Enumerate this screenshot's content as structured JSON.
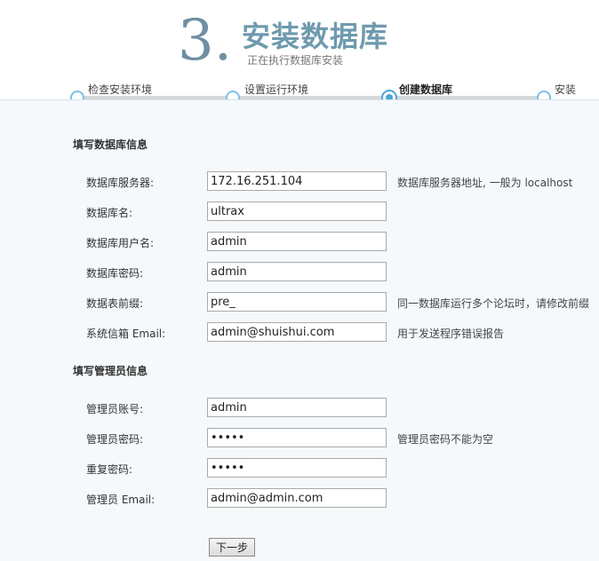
{
  "header": {
    "step_number": "3.",
    "title": "安装数据库",
    "subtitle": "正在执行数据库安装"
  },
  "steps": [
    {
      "label": "检查安装环境",
      "state": "done"
    },
    {
      "label": "设置运行环境",
      "state": "done"
    },
    {
      "label": "创建数据库",
      "state": "active"
    },
    {
      "label": "安装",
      "state": "pending"
    }
  ],
  "db_section": {
    "title": "填写数据库信息",
    "fields": [
      {
        "label": "数据库服务器:",
        "value": "172.16.251.104",
        "hint": "数据库服务器地址, 一般为 localhost"
      },
      {
        "label": "数据库名:",
        "value": "ultrax",
        "hint": ""
      },
      {
        "label": "数据库用户名:",
        "value": "admin",
        "hint": ""
      },
      {
        "label": "数据库密码:",
        "value": "admin",
        "hint": ""
      },
      {
        "label": "数据表前缀:",
        "value": "pre_",
        "hint": "同一数据库运行多个论坛时，请修改前缀"
      },
      {
        "label": "系统信箱 Email:",
        "value": "admin@shuishui.com",
        "hint": "用于发送程序错误报告"
      }
    ]
  },
  "admin_section": {
    "title": "填写管理员信息",
    "fields": [
      {
        "label": "管理员账号:",
        "value": "admin",
        "hint": ""
      },
      {
        "label": "管理员密码:",
        "value": "•••••",
        "hint": "管理员密码不能为空"
      },
      {
        "label": "重复密码:",
        "value": "•••••",
        "hint": ""
      },
      {
        "label": "管理员 Email:",
        "value": "admin@admin.com",
        "hint": ""
      }
    ]
  },
  "buttons": {
    "next": "下一步"
  }
}
